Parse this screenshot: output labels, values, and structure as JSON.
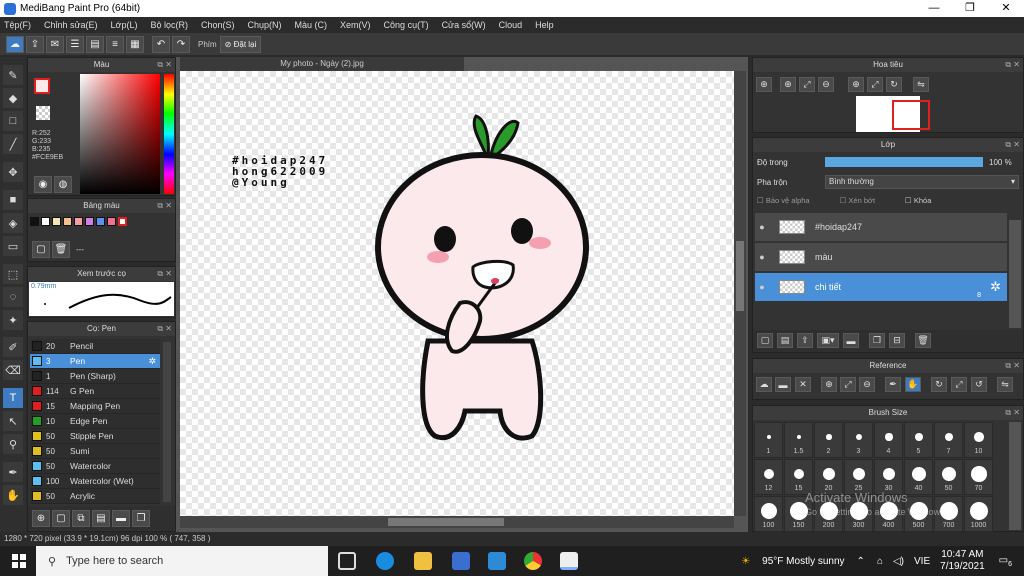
{
  "window": {
    "title": "MediBang Paint Pro (64bit)",
    "min": "—",
    "max": "❐",
    "close": "✕"
  },
  "menu": [
    "Tệp(F)",
    "Chỉnh sửa(E)",
    "Lớp(L)",
    "Bộ lọc(R)",
    "Chọn(S)",
    "Chụp(N)",
    "Màu (C)",
    "Xem(V)",
    "Công cụ(T)",
    "Cửa sổ(W)",
    "Cloud",
    "Help"
  ],
  "toolbar": {
    "label_phim": "Phím",
    "reset": "Đặt lại"
  },
  "color_panel": {
    "title": "Màu",
    "r": "R:252",
    "g": "G:233",
    "b": "B:235",
    "hex": "#FCE9EB",
    "fg_color": "#FCE9EB"
  },
  "palette_panel": {
    "title": "Bảng màu",
    "colors": [
      "#111111",
      "#ffffff",
      "#f4e4b8",
      "#f2c28a",
      "#f0a0a0",
      "#d080e0",
      "#6090f0",
      "#f07090",
      "#ffffff"
    ],
    "dash": "---"
  },
  "preview_panel": {
    "title": "Xem trước cọ",
    "size": "0.79mm"
  },
  "brush_panel": {
    "title": "Cọ: Pen",
    "brushes": [
      {
        "size": "20",
        "name": "Pencil",
        "color": "#222222"
      },
      {
        "size": "3",
        "name": "Pen",
        "color": "#5bc0f0"
      },
      {
        "size": "1",
        "name": "Pen (Sharp)",
        "color": "#222222"
      },
      {
        "size": "114",
        "name": "G Pen",
        "color": "#e02020"
      },
      {
        "size": "15",
        "name": "Mapping Pen",
        "color": "#e02020"
      },
      {
        "size": "10",
        "name": "Edge Pen",
        "color": "#20a020"
      },
      {
        "size": "50",
        "name": "Stipple Pen",
        "color": "#e0c020"
      },
      {
        "size": "50",
        "name": "Sumi",
        "color": "#e0c020"
      },
      {
        "size": "50",
        "name": "Watercolor",
        "color": "#5bc0f0"
      },
      {
        "size": "100",
        "name": "Watercolor (Wet)",
        "color": "#5bc0f0"
      },
      {
        "size": "50",
        "name": "Acrylic",
        "color": "#e0c020"
      }
    ]
  },
  "document": {
    "tab": "My photo - Ngày (2).jpg",
    "text_lines": [
      "#hoidap247",
      "hong622009",
      "@Young"
    ]
  },
  "navigator_panel": {
    "title": "Hoa tiêu"
  },
  "layer_panel": {
    "title": "Lớp",
    "opacity_label": "Độ trong",
    "opacity_value": "100 %",
    "opacity_fraction": 1.0,
    "blend_label": "Pha trộn",
    "blend_value": "Bình thường",
    "protect_alpha": "Bảo vệ alpha",
    "clipping": "Xén bớt",
    "lock": "Khóa",
    "layers": [
      {
        "name": "#hoidap247",
        "selected": false
      },
      {
        "name": "màu",
        "selected": false
      },
      {
        "name": "chi tiết",
        "selected": true,
        "badge": "8"
      }
    ]
  },
  "reference_panel": {
    "title": "Reference"
  },
  "brushsize_panel": {
    "title": "Brush Size",
    "sizes": [
      "1",
      "1.5",
      "2",
      "3",
      "4",
      "5",
      "7",
      "10",
      "12",
      "15",
      "20",
      "25",
      "30",
      "40",
      "50",
      "70",
      "100",
      "150",
      "200",
      "300",
      "400",
      "500",
      "700",
      "1000"
    ]
  },
  "watermark": {
    "line1": "Activate Windows",
    "line2": "Go to Settings to activate Windows."
  },
  "status": "1280 * 720 pixel   (33.9 * 19.1cm)   96 dpi   100 %   ( 747, 358 )",
  "taskbar": {
    "search_placeholder": "Type here to search",
    "weather": "95°F  Mostly sunny",
    "lang": "VIE",
    "time": "10:47 AM",
    "date": "7/19/2021",
    "notif": "6"
  }
}
